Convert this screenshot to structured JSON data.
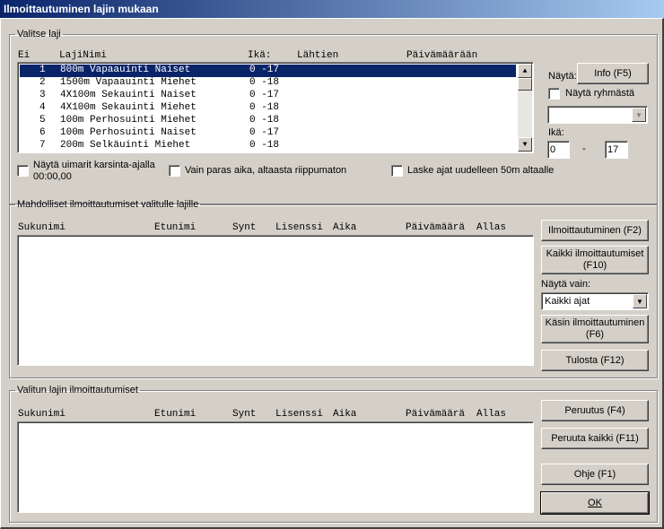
{
  "window": {
    "title": "Ilmoittautuminen lajin mukaan"
  },
  "select_event": {
    "legend": "Valitse laji",
    "headers": {
      "ei": "Ei",
      "name": "LajiNimi",
      "age": "Ikä:",
      "start": "Lähtien",
      "date": "Päivämäärään"
    },
    "rows": [
      {
        "no": "1",
        "name": "800m Vapaauinti Naiset",
        "age": "0 -17",
        "selected": true
      },
      {
        "no": "2",
        "name": "1500m Vapaauinti Miehet",
        "age": "0 -18",
        "selected": false
      },
      {
        "no": "3",
        "name": "4X100m Sekauinti Naiset",
        "age": "0 -17",
        "selected": false
      },
      {
        "no": "4",
        "name": "4X100m Sekauinti Miehet",
        "age": "0 -18",
        "selected": false
      },
      {
        "no": "5",
        "name": "100m Perhosuinti Miehet",
        "age": "0 -18",
        "selected": false
      },
      {
        "no": "6",
        "name": "100m Perhosuinti Naiset",
        "age": "0 -17",
        "selected": false
      },
      {
        "no": "7",
        "name": "200m Selkäuinti Miehet",
        "age": "0 -18",
        "selected": false
      }
    ],
    "show_label": "Näytä:",
    "info_button": "Info (F5)",
    "show_group_label": "Näytä ryhmästä",
    "group_value": "",
    "age_label": "Ikä:",
    "age_from": "0",
    "age_dash": "-",
    "age_to": "17",
    "chk_swimmers_line1": "Näytä uimarit karsinta-ajalla",
    "chk_swimmers_line2": "00:00,00",
    "chk_best_only": "Vain paras aika, altaasta riippumaton",
    "chk_recalc": "Laske ajat uudelleen 50m altaalle"
  },
  "possible": {
    "legend": "Mahdolliset ilmoittautumiset valitulle lajille",
    "headers": {
      "last": "Sukunimi",
      "first": "Etunimi",
      "born": "Synt",
      "license": "Lisenssi",
      "time": "Aika",
      "date": "Päivämäärä",
      "pool": "Allas"
    },
    "btn_register": "Ilmoittautuminen (F2)",
    "btn_register_all_line1": "Kaikki ilmoittautumiset",
    "btn_register_all_line2": "(F10)",
    "show_only_label": "Näytä vain:",
    "show_only_value": "Kaikki ajat",
    "btn_manual_line1": "Käsin ilmoittautuminen",
    "btn_manual_line2": "(F6)",
    "btn_print": "Tulosta (F12)"
  },
  "selected_entries": {
    "legend": "Valitun lajin ilmoittautumiset",
    "headers": {
      "last": "Sukunimi",
      "first": "Etunimi",
      "born": "Synt",
      "license": "Lisenssi",
      "time": "Aika",
      "date": "Päivämäärä",
      "pool": "Allas"
    },
    "btn_cancel": "Peruutus (F4)",
    "btn_cancel_all": "Peruuta kaikki (F11)",
    "btn_help": "Ohje (F1)",
    "btn_ok": "OK"
  }
}
